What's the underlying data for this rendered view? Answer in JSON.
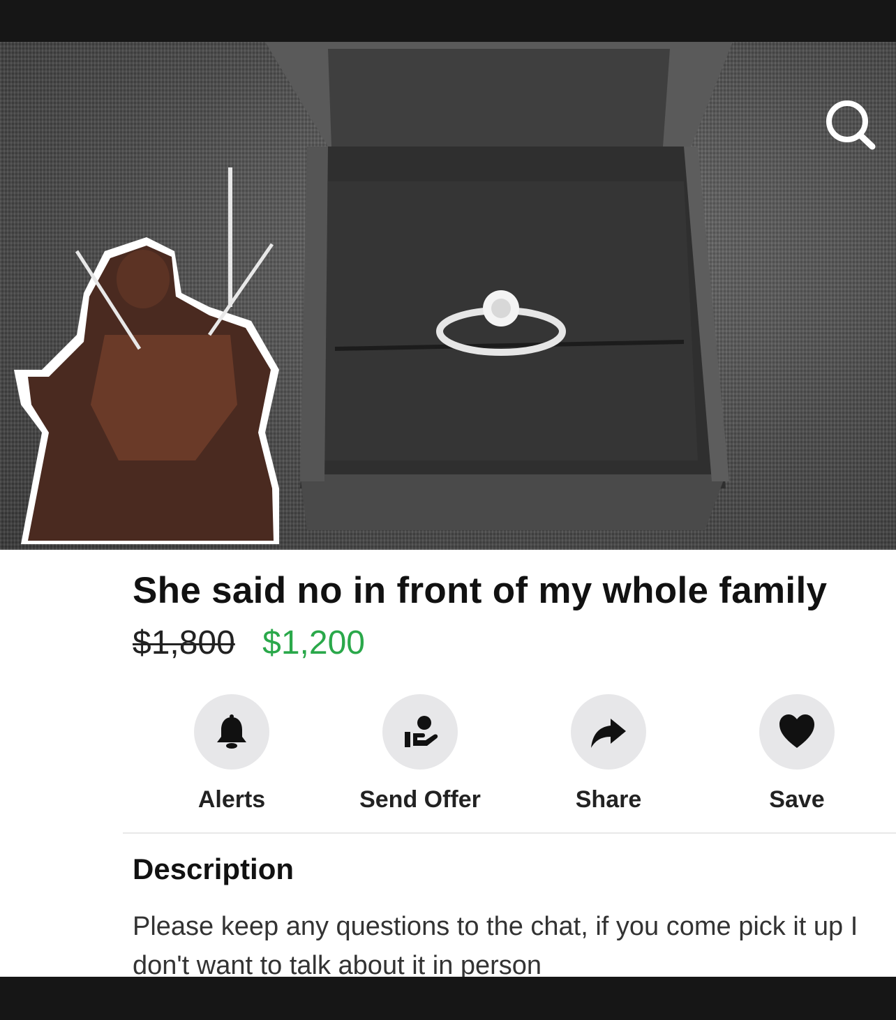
{
  "listing": {
    "title": "She said no in front of my whole family",
    "original_price": "$1,800",
    "sale_price": "$1,200"
  },
  "toolbar": {
    "search_icon": "search-icon"
  },
  "actions": [
    {
      "label": "Alerts",
      "icon": "bell-icon"
    },
    {
      "label": "Send Offer",
      "icon": "offer-icon"
    },
    {
      "label": "Share",
      "icon": "share-arrow-icon"
    },
    {
      "label": "Save",
      "icon": "heart-icon"
    }
  ],
  "description": {
    "heading": "Description",
    "body": "Please keep any questions to the chat, if you come pick it up I don't want to talk about it in person"
  },
  "colors": {
    "sale_price": "#2aa84a",
    "icon_circle": "#e7e7e9"
  }
}
